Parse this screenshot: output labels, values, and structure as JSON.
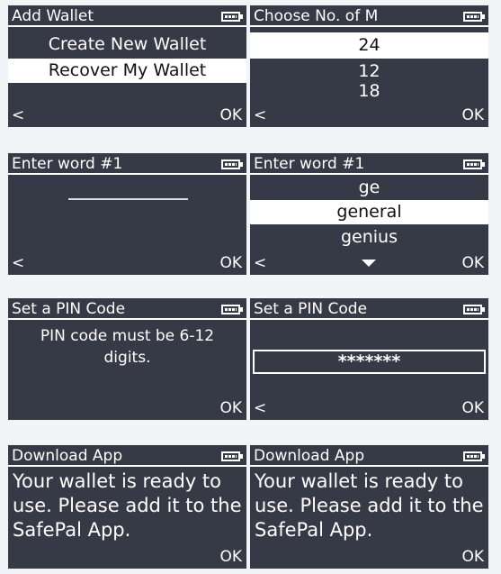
{
  "screens": [
    {
      "title": "Add Wallet",
      "items": [
        "Create New Wallet",
        "Recover My Wallet"
      ],
      "selected_item": "Recover My Wallet",
      "left_softkey": "<",
      "right_softkey": "OK"
    },
    {
      "title": "Choose No. of M",
      "items": [
        "24",
        "12",
        "18"
      ],
      "selected_item": "24",
      "left_softkey": "<",
      "right_softkey": "OK"
    },
    {
      "title": "Enter word #1",
      "input_value": "",
      "left_softkey": "<",
      "right_softkey": "OK"
    },
    {
      "title": "Enter word #1",
      "items": [
        "ge",
        "general",
        "genius"
      ],
      "selected_item": "general",
      "left_softkey": "<",
      "right_softkey": "OK"
    },
    {
      "title": "Set a PIN Code",
      "message": "PIN code must be 6-12 digits.",
      "right_softkey": "OK"
    },
    {
      "title": "Set a PIN Code",
      "pin_value": "*******",
      "left_softkey": "<",
      "right_softkey": "OK"
    },
    {
      "title": "Download App",
      "message": "Your wallet is ready to use. Please add it to the SafePal App.",
      "right_softkey": "OK"
    },
    {
      "title": "Download App",
      "message": "Your wallet is ready to use. Please add it to the SafePal App.",
      "right_softkey": "OK"
    }
  ],
  "icons": {
    "battery": "battery-icon",
    "scroll_down": "triangle-down-icon"
  },
  "colors": {
    "screen_bg": "#353a46",
    "page_bg": "#f2f4f7",
    "highlight": "#ffffff"
  }
}
